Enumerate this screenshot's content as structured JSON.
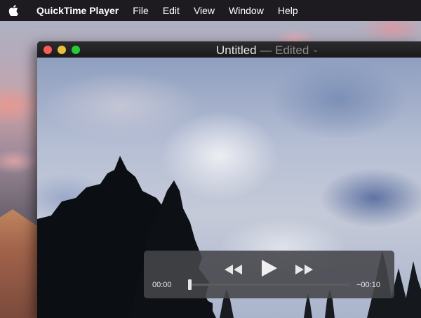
{
  "menubar": {
    "apple_icon": "apple-logo-icon",
    "app_name": "QuickTime Player",
    "items": [
      "File",
      "Edit",
      "View",
      "Window",
      "Help"
    ]
  },
  "window": {
    "title": "Untitled",
    "title_separator": " — ",
    "title_status": "Edited",
    "title_chevron_icon": "chevron-down-icon",
    "traffic_lights": {
      "close": "#fc5b57",
      "minimize": "#e5bf3c",
      "zoom": "#27c937"
    }
  },
  "player": {
    "elapsed": "00:00",
    "remaining": "−00:10",
    "progress": 0.0,
    "controls": [
      "rewind-icon",
      "play-icon",
      "fast-forward-icon"
    ]
  }
}
